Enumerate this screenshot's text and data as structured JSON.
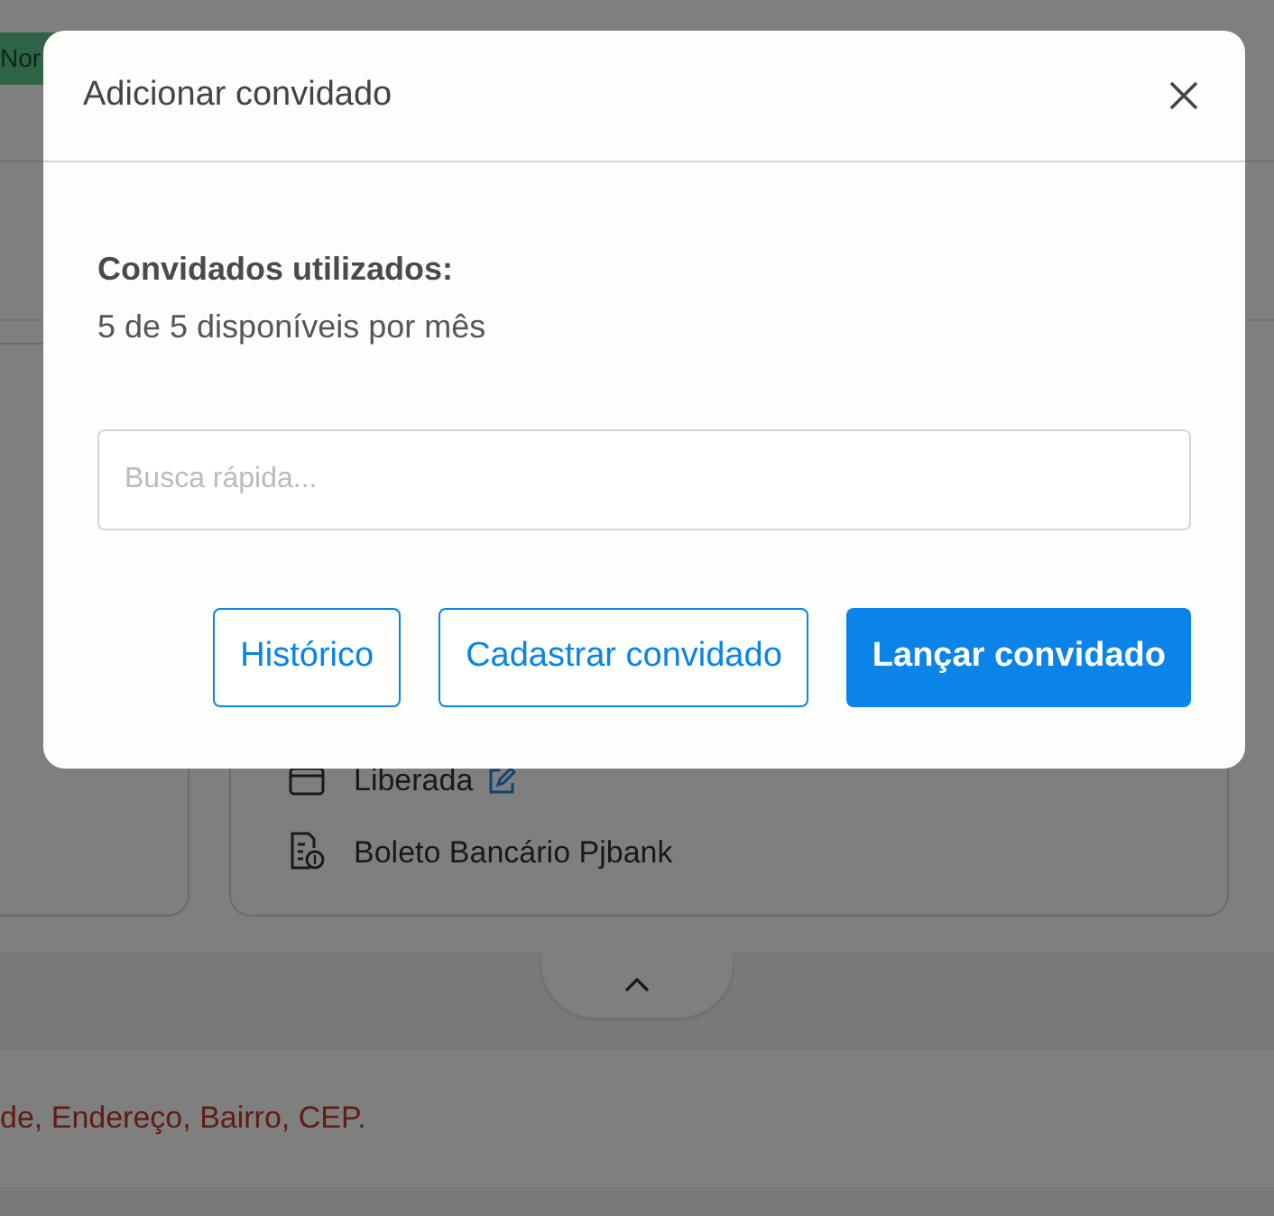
{
  "background": {
    "badge": "Nor",
    "payment_items": [
      {
        "kind": "status",
        "text": "Liberada",
        "editable": true
      },
      {
        "kind": "method",
        "text": "Boleto Bancário Pjbank",
        "editable": false
      }
    ],
    "notice": "de, Endereço, Bairro, CEP."
  },
  "modal": {
    "title": "Adicionar convidado",
    "used_label": "Convidados utilizados:",
    "used_value": "5 de 5 disponíveis por mês",
    "search": {
      "placeholder": "Busca rápida..."
    },
    "buttons": [
      {
        "label": "Histórico",
        "kind": "outline"
      },
      {
        "label": "Cadastrar convidado",
        "kind": "outline"
      },
      {
        "label": "Lançar convidado",
        "kind": "primary"
      }
    ]
  }
}
